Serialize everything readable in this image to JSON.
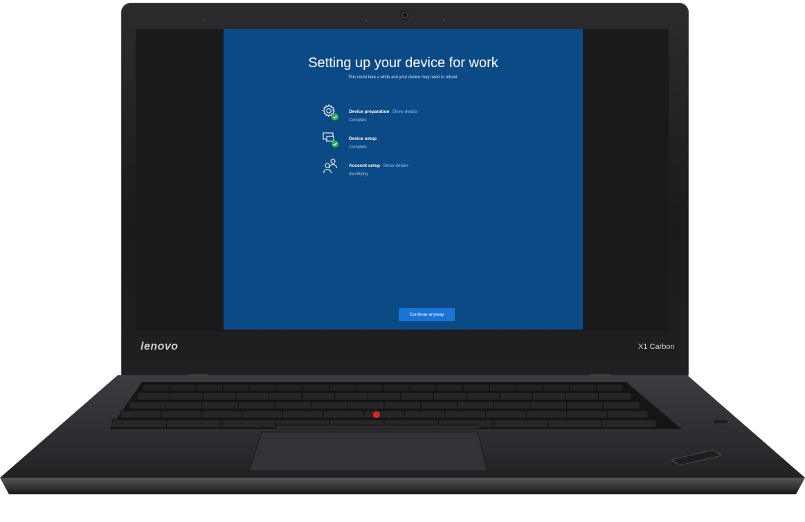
{
  "device": {
    "brand": "lenovo",
    "model": "X1 Carbon"
  },
  "setup": {
    "title": "Setting up your device for work",
    "subtitle": "This could take a while and your device may need to reboot.",
    "steps": [
      {
        "name": "Device preparation",
        "link": "Show details",
        "status": "Complete",
        "icon": "gear-icon",
        "done": true
      },
      {
        "name": "Device setup",
        "link": "",
        "status": "Complete",
        "icon": "devices-icon",
        "done": true
      },
      {
        "name": "Account setup",
        "link": "Show details",
        "status": "Identifying",
        "icon": "people-icon",
        "done": false
      }
    ],
    "continue_label": "Continue anyway"
  },
  "colors": {
    "screen_bg": "#0c4a86",
    "button_bg": "#1a73d6",
    "link": "#7cc3ff",
    "check": "#2fb34a",
    "trackpoint": "#d8262b"
  }
}
